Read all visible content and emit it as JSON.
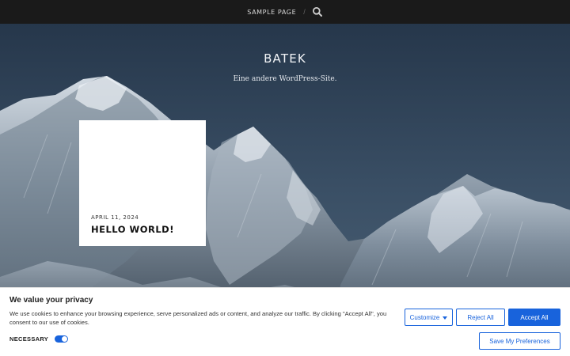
{
  "nav": {
    "sample_page": "SAMPLE PAGE",
    "separator": "/",
    "search_icon": "search-icon"
  },
  "site": {
    "title": "BATEK",
    "tagline": "Eine andere WordPress-Site."
  },
  "post": {
    "date": "APRIL 11, 2024",
    "title": "HELLO WORLD!"
  },
  "cookie": {
    "title": "We value your privacy",
    "text": "We use cookies to enhance your browsing experience, serve personalized ads or content, and analyze our traffic. By clicking \"Accept All\", you consent to our use of cookies.",
    "necessary_label": "NECESSARY",
    "customize_label": "Customize",
    "reject_label": "Reject All",
    "accept_label": "Accept All",
    "save_label": "Save My Preferences"
  },
  "colors": {
    "accent": "#1863dc",
    "topbar": "#1a1a1a"
  }
}
